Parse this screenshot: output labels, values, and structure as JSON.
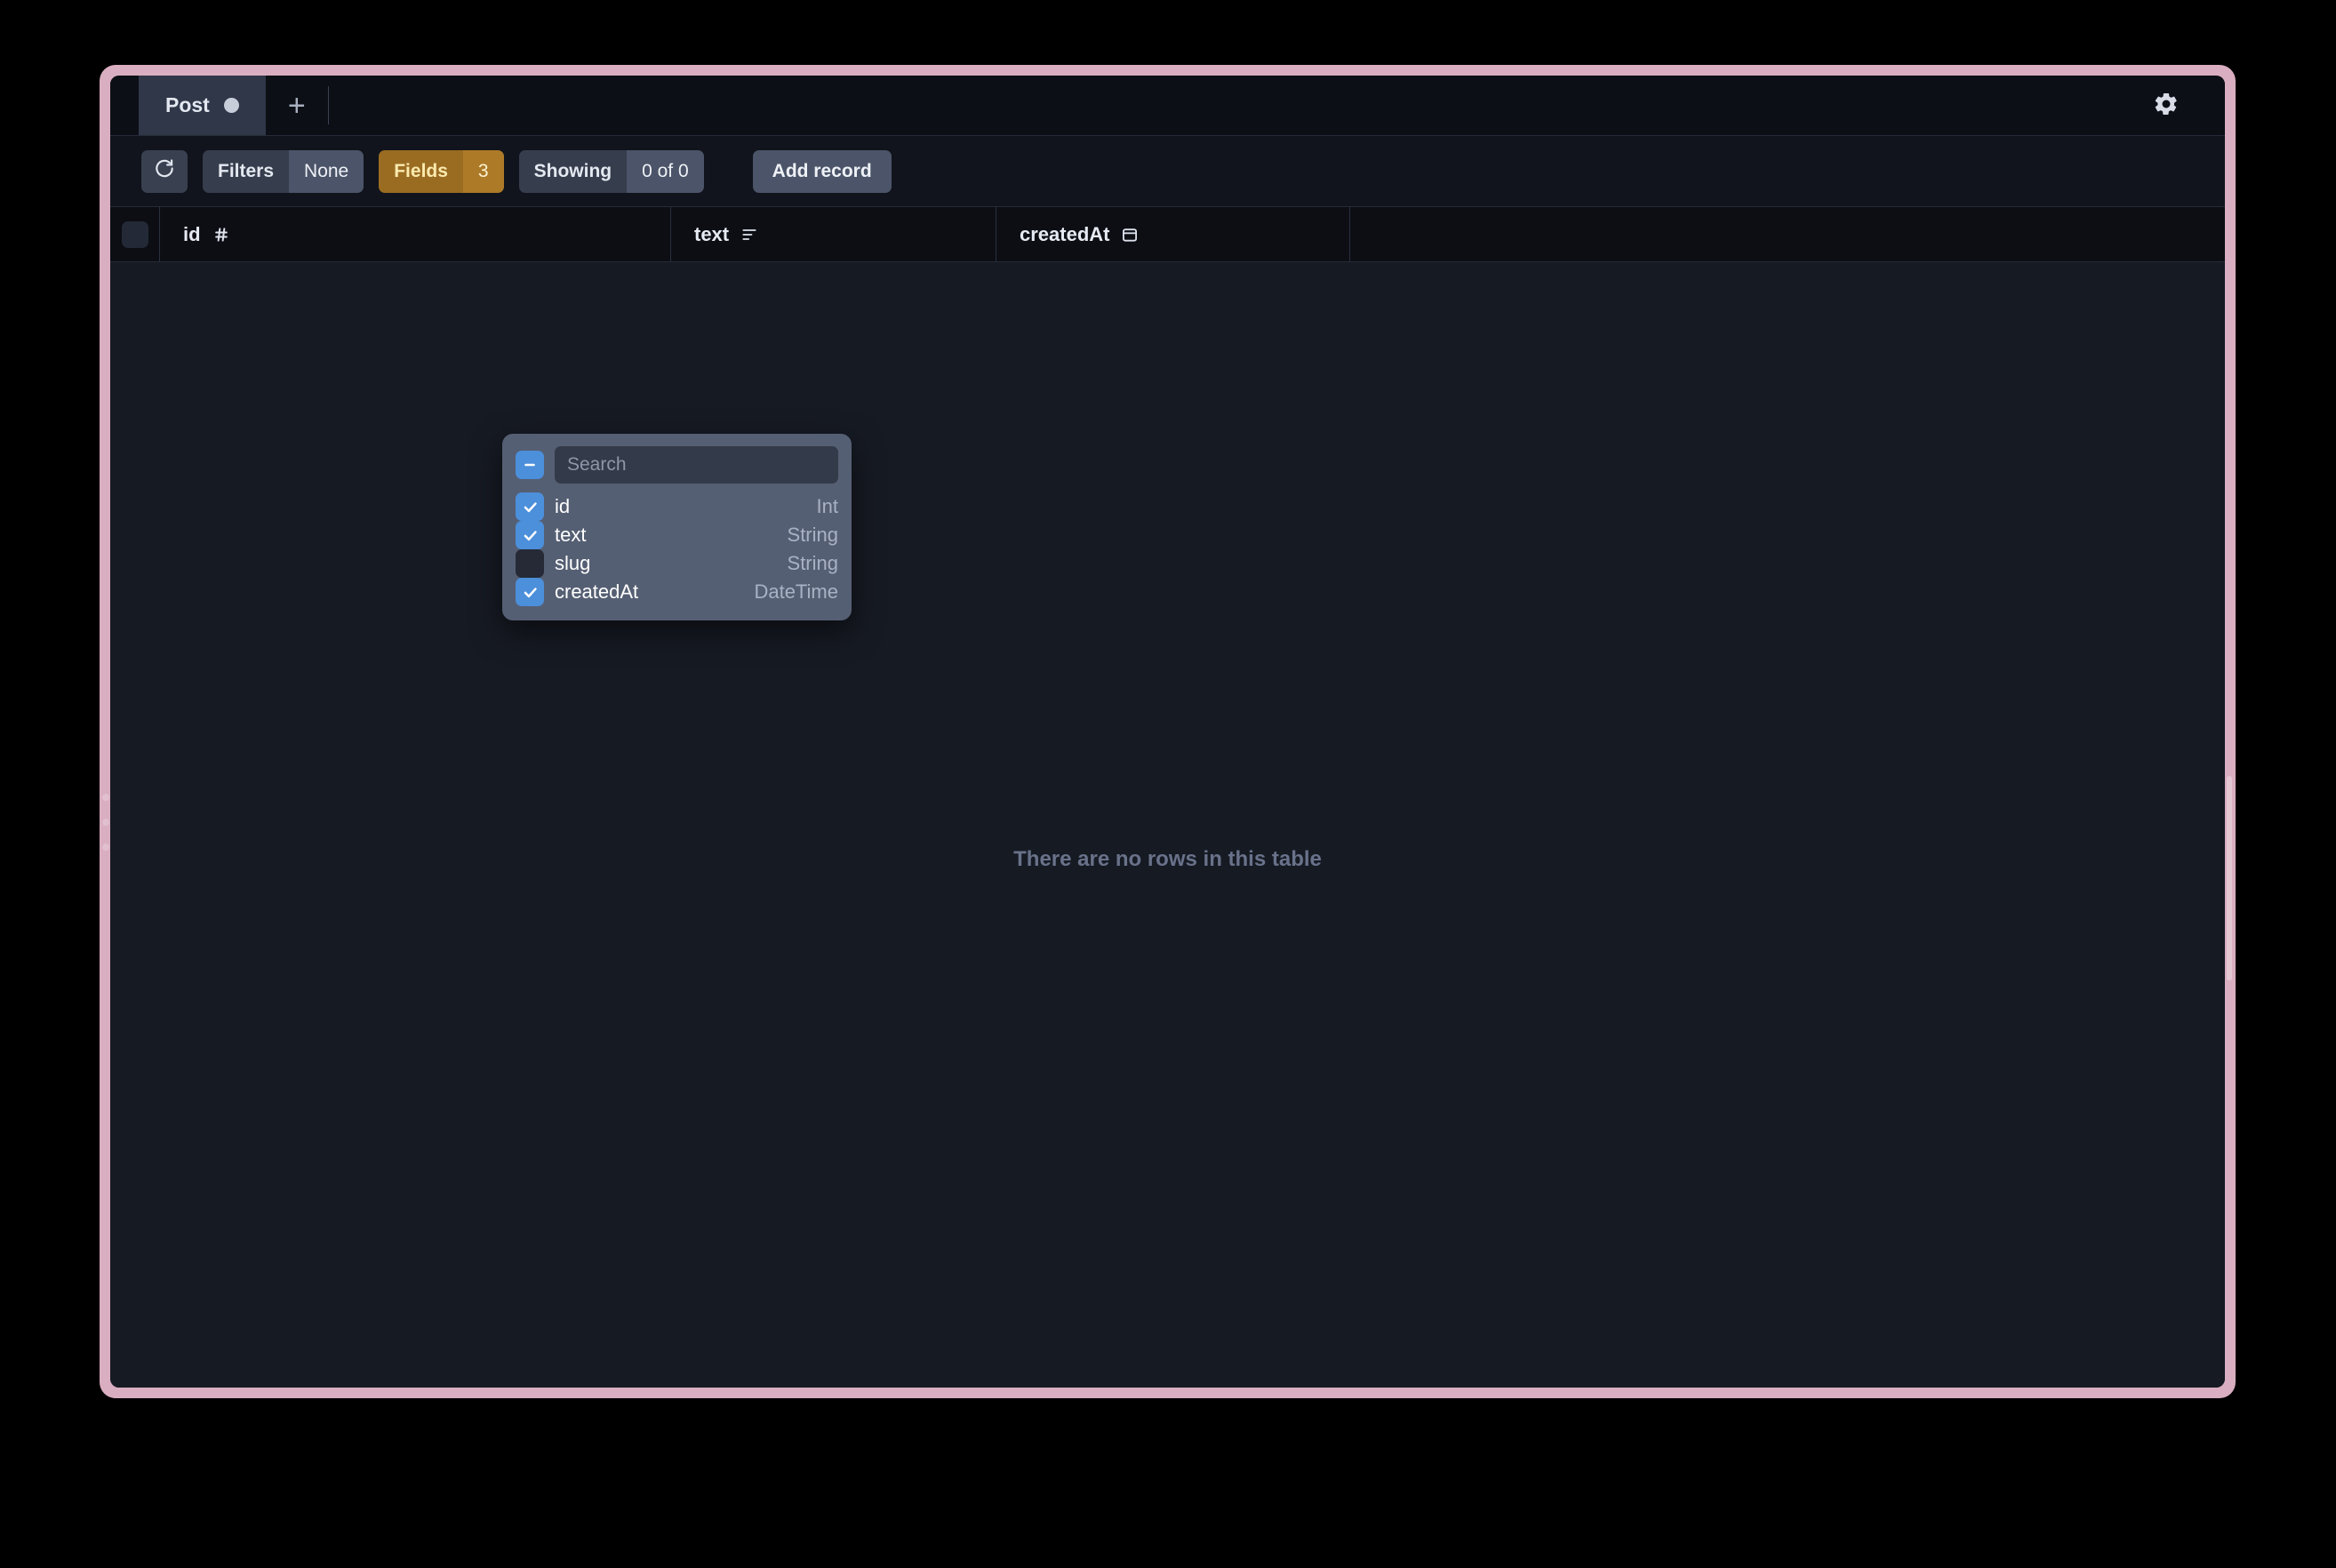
{
  "window": {
    "accent_border_color": "#d9aec0",
    "background_color": "#161a23"
  },
  "tabbar": {
    "tabs": [
      {
        "label": "Post",
        "status_dot": "filled-circle-icon",
        "active": true
      }
    ],
    "add_tab_label": "+",
    "settings_icon": "gear-icon"
  },
  "toolbar": {
    "refresh_icon": "refresh-icon",
    "filters": {
      "label": "Filters",
      "value": "None"
    },
    "fields": {
      "label": "Fields",
      "value": "3",
      "accent_color": "#ad7a28",
      "active": true
    },
    "showing": {
      "label": "Showing",
      "value": "0 of 0"
    },
    "add_record_label": "Add record"
  },
  "table": {
    "select_all_checkbox": "unchecked",
    "columns": [
      {
        "name": "id",
        "type_icon": "hash-icon"
      },
      {
        "name": "text",
        "type_icon": "text-icon"
      },
      {
        "name": "createdAt",
        "type_icon": "calendar-icon"
      }
    ],
    "rows": [],
    "empty_message": "There are no rows in this table"
  },
  "fields_dropdown": {
    "open": true,
    "select_all_state": "indeterminate",
    "search": {
      "value": "",
      "placeholder": "Search"
    },
    "fields": [
      {
        "name": "id",
        "type": "Int",
        "checked": true
      },
      {
        "name": "text",
        "type": "String",
        "checked": true
      },
      {
        "name": "slug",
        "type": "String",
        "checked": false
      },
      {
        "name": "createdAt",
        "type": "DateTime",
        "checked": true
      }
    ]
  }
}
